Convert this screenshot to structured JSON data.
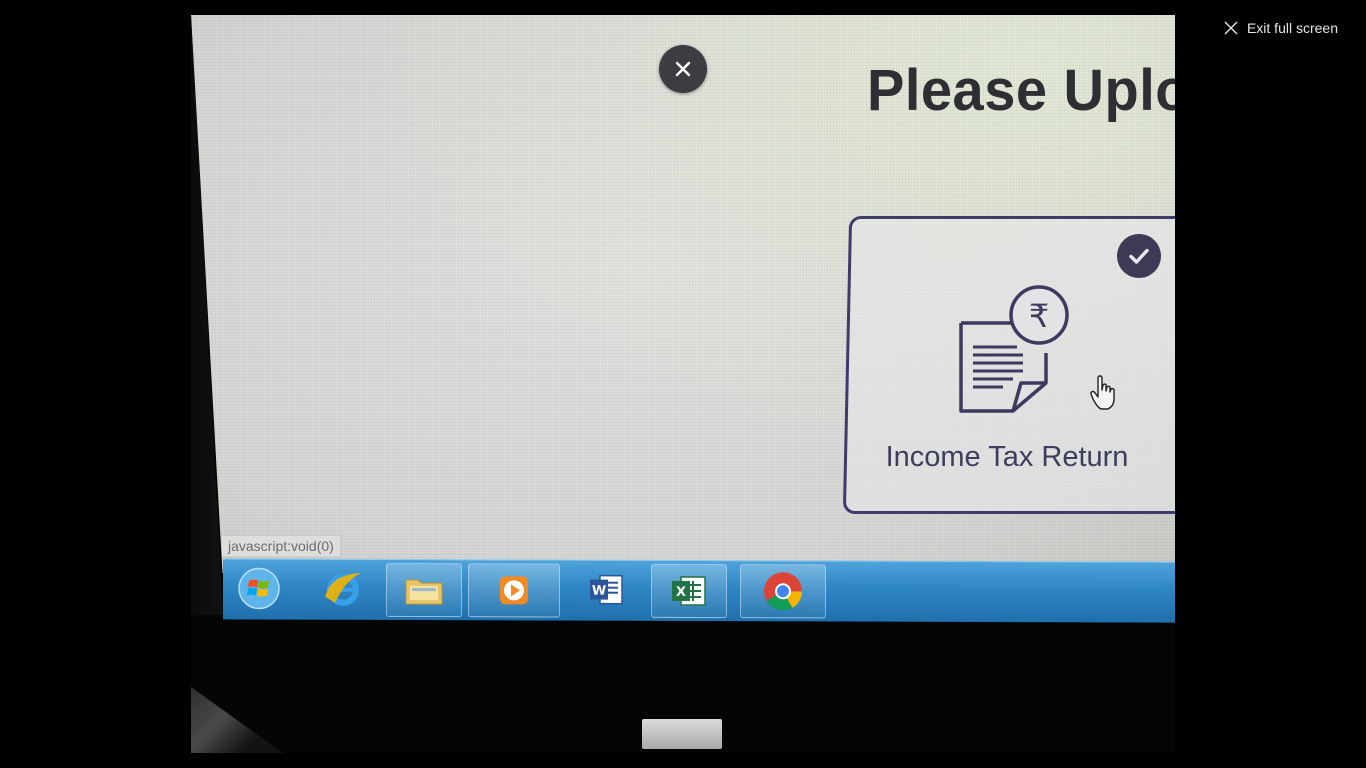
{
  "viewer": {
    "exit_fullscreen_label": "Exit full screen"
  },
  "screen": {
    "heading": "Please Uplo",
    "card": {
      "label": "Income Tax Return",
      "selected": true,
      "currency_symbol": "₹"
    },
    "status_bar_url": "javascript:void(0)"
  },
  "taskbar": {
    "items": [
      {
        "name": "start-button",
        "icon": "windows-logo-icon"
      },
      {
        "name": "internet-explorer",
        "icon": "internet-explorer-icon"
      },
      {
        "name": "file-explorer",
        "icon": "folder-icon"
      },
      {
        "name": "media-player",
        "icon": "media-player-icon"
      },
      {
        "name": "microsoft-word",
        "icon": "word-icon"
      },
      {
        "name": "microsoft-excel",
        "icon": "excel-icon"
      },
      {
        "name": "google-chrome",
        "icon": "chrome-icon"
      }
    ]
  },
  "colors": {
    "background": "#000000",
    "card_border": "#3f3b6a",
    "check_badge": "#3c3a55",
    "taskbar": "#2f86c4",
    "close_button": "#3b3d42"
  }
}
